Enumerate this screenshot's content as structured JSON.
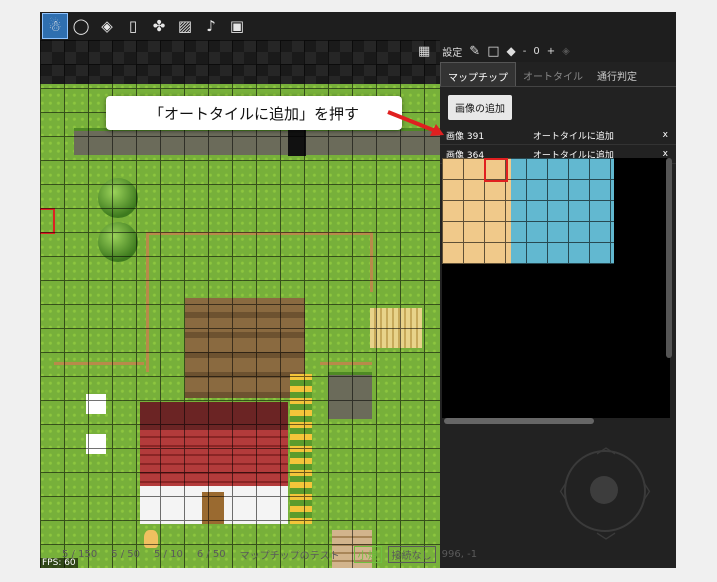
{
  "toolbar": {
    "icons": [
      "character-icon",
      "balloon-icon",
      "layers-icon",
      "book-icon",
      "puzzle-icon",
      "image-icon",
      "music-icon",
      "save-icon"
    ]
  },
  "panel": {
    "settings_label": "設定",
    "counter_minus": "-",
    "counter_value": "0",
    "counter_plus": "+",
    "tabs": [
      "マップチップ",
      "オートタイル",
      "通行判定"
    ],
    "add_image_button": "画像の追加",
    "images": [
      {
        "name": "画像 391",
        "action": "オートタイルに追加",
        "close": "x"
      },
      {
        "name": "画像 364",
        "action": "オートタイルに追加",
        "close": "x"
      }
    ]
  },
  "callout": {
    "text": "「オートタイルに追加」を押す"
  },
  "status": {
    "fps": "FPS: 60",
    "items": [
      "5 / 150",
      "5 / 50",
      "5 / 10",
      "6 / 50"
    ],
    "map_name": "マップチップのテスト",
    "size_badge": "小規",
    "connection_badge": "接続なし",
    "coords": "996, -1"
  },
  "colors": {
    "accent": "#2f6fb0",
    "arrow_red": "#e02020"
  }
}
